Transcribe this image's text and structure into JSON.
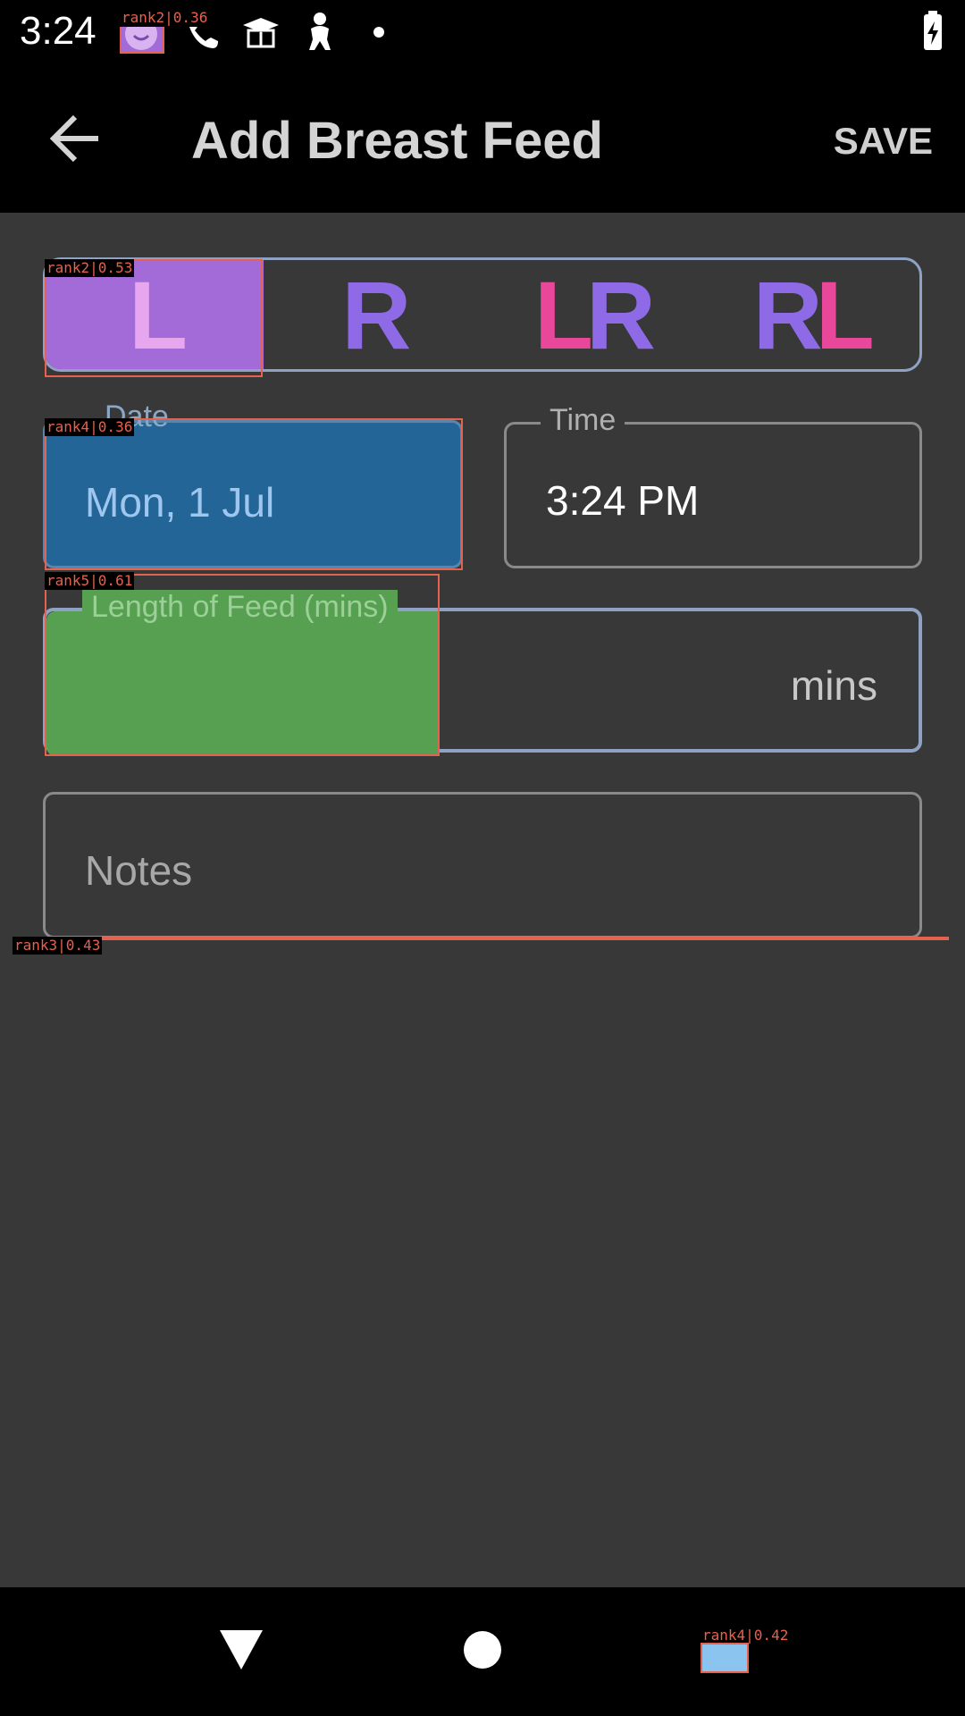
{
  "status_bar": {
    "time": "3:24",
    "icons": [
      "baby-face-icon",
      "phone-icon",
      "graduation-cap-icon",
      "baby-icon",
      "dot-icon",
      "battery-charging-icon"
    ]
  },
  "app_bar": {
    "title": "Add Breast Feed",
    "save_label": "SAVE",
    "back_icon": "back-arrow-icon"
  },
  "side_selector": {
    "options": [
      {
        "first": "L",
        "second": ""
      },
      {
        "first": "R",
        "second": ""
      },
      {
        "first": "L",
        "second": "R"
      },
      {
        "first": "R",
        "second": "L"
      }
    ],
    "selected": "L"
  },
  "date_field": {
    "label": "Date",
    "value": "Mon, 1 Jul"
  },
  "time_field": {
    "label": "Time",
    "value": "3:24 PM"
  },
  "length_field": {
    "label": "Length of Feed (mins)",
    "suffix": "mins",
    "value": ""
  },
  "notes_field": {
    "placeholder": "Notes"
  },
  "annotations": [
    {
      "tag": "rank2|0.36"
    },
    {
      "tag": "rank2|0.53"
    },
    {
      "tag": "rank4|0.36"
    },
    {
      "tag": "rank5|0.61"
    },
    {
      "tag": "rank3|0.43"
    },
    {
      "tag": "rank4|0.42"
    }
  ],
  "colors": {
    "background": "#383838",
    "selected": "#a26bd8",
    "violet_letter": "#8e6ae6",
    "pink_letter": "#e9489a",
    "date_fill": "#236596",
    "length_fill": "#57a052",
    "highlight": "#e5624f"
  },
  "nav_bar": {
    "icons": [
      "back-triangle-icon",
      "home-circle-icon",
      "recents-square-icon"
    ]
  }
}
